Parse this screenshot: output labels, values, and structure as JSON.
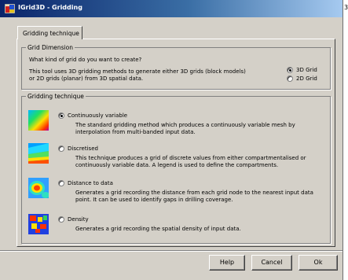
{
  "window": {
    "title": "IGrid3D - Gridding",
    "close_fragment": "3"
  },
  "tab": {
    "label": "Gridding technique"
  },
  "grid_dimension": {
    "legend": "Grid Dimension",
    "question": "What kind of grid do you want to create?",
    "desc_line1": "This tool uses 3D gridding methods to generate either 3D grids (block models)",
    "desc_line2": "or 2D grids (planar) from 3D spatial data.",
    "options": [
      {
        "label": "3D Grid",
        "selected": true
      },
      {
        "label": "2D Grid",
        "selected": false
      }
    ]
  },
  "technique": {
    "legend": "Gridding technique",
    "options": [
      {
        "label": "Continuously variable",
        "selected": true,
        "icon": "continuous-surface-icon",
        "desc1": "The standard gridding method which produces a continuously variable mesh by",
        "desc2": "interpolation from multi-banded input data."
      },
      {
        "label": "Discretised",
        "selected": false,
        "icon": "discretised-surface-icon",
        "desc1": "This technique produces a grid of discrete values from either compartmentalised or",
        "desc2": "continuously variable data. A legend is used to define the compartments."
      },
      {
        "label": "Distance to data",
        "selected": false,
        "icon": "distance-surface-icon",
        "desc1": "Generates a grid recording the distance from each grid node to the nearest input data",
        "desc2": "point. It can be used to identify gaps in drilling coverage."
      },
      {
        "label": "Density",
        "selected": false,
        "icon": "density-surface-icon",
        "desc1": "Generates a grid recording the spatial density of input data.",
        "desc2": ""
      }
    ]
  },
  "buttons": {
    "help": "Help",
    "cancel": "Cancel",
    "ok": "Ok"
  }
}
